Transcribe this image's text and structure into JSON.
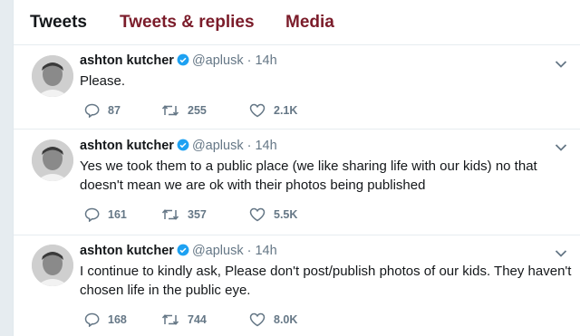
{
  "tabs": [
    {
      "label": "Tweets"
    },
    {
      "label": "Tweets & replies"
    },
    {
      "label": "Media"
    }
  ],
  "tweets": [
    {
      "name": "ashton kutcher",
      "handle": "@aplusk",
      "dot": "·",
      "time": "14h",
      "text": "Please.",
      "replies": "87",
      "retweets": "255",
      "likes": "2.1K"
    },
    {
      "name": "ashton kutcher",
      "handle": "@aplusk",
      "dot": "·",
      "time": "14h",
      "text": "Yes we took them to a public place (we like sharing life with our kids) no that doesn't mean we are ok with their photos being published",
      "replies": "161",
      "retweets": "357",
      "likes": "5.5K"
    },
    {
      "name": "ashton kutcher",
      "handle": "@aplusk",
      "dot": "·",
      "time": "14h",
      "text": "I continue to kindly ask, Please don't post/publish photos of our kids. They haven't chosen life in the public eye.",
      "replies": "168",
      "retweets": "744",
      "likes": "8.0K"
    }
  ],
  "colors": {
    "tab_active": "#14171a",
    "tab_inactive": "#7b1c2a",
    "verified": "#1da1f2",
    "muted": "#657786"
  }
}
